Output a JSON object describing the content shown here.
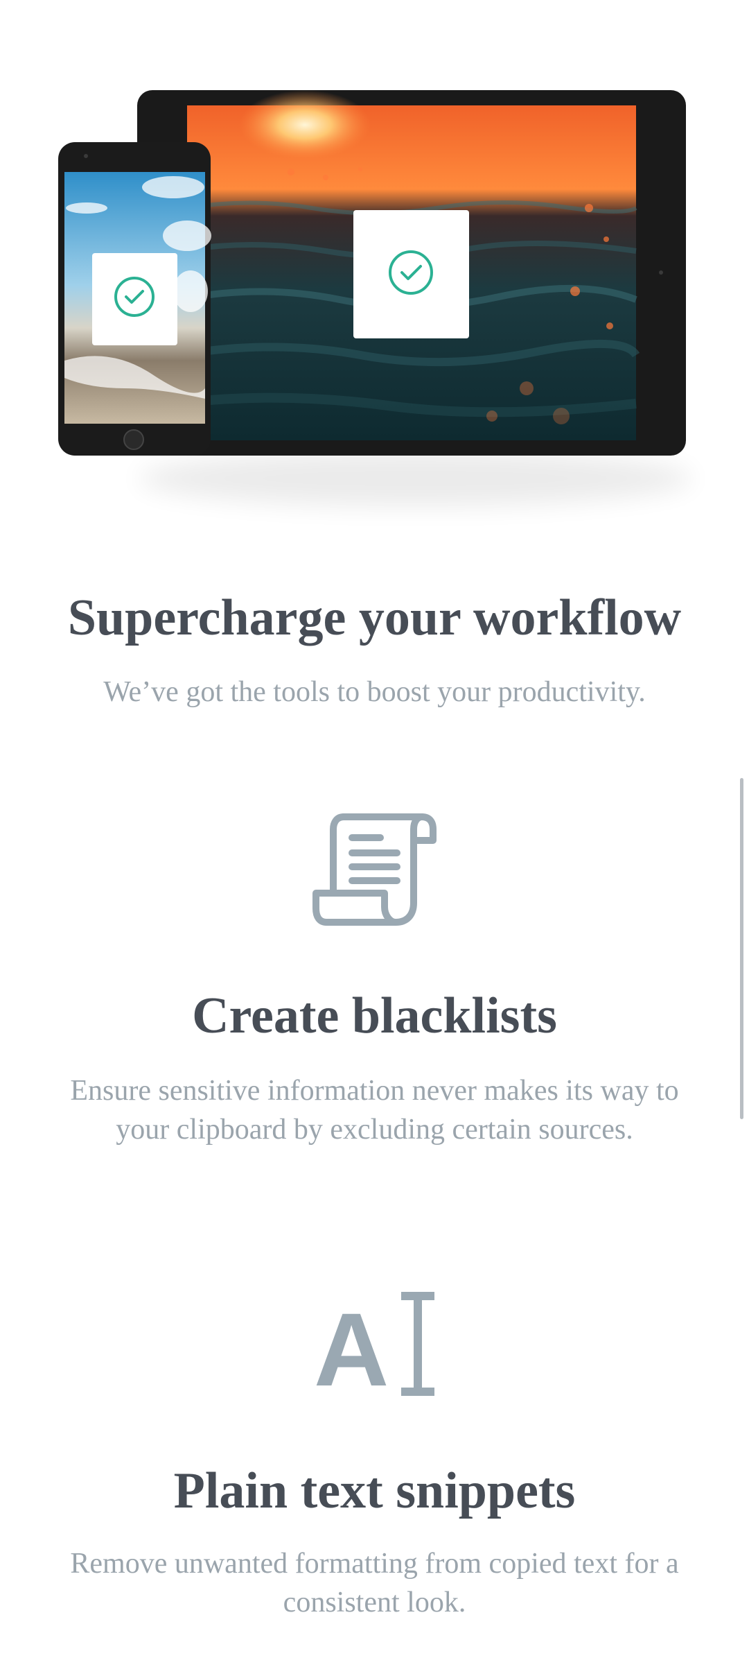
{
  "hero": {
    "tablet_image": "sunset-ocean-waves",
    "phone_image": "beach-sky",
    "card_icon": "check-circle-icon",
    "accent_color": "#2bb193"
  },
  "intro": {
    "title": "Supercharge your workflow",
    "subtitle": "We’ve got the tools to boost your productivity."
  },
  "features": [
    {
      "icon": "scroll-document-icon",
      "title": "Create blacklists",
      "description": "Ensure sensitive information never makes its way to your clipboard by excluding certain sources."
    },
    {
      "icon": "text-cursor-icon",
      "icon_text": "A",
      "title": "Plain text snippets",
      "description": "Remove unwanted formatting from copied text for a consistent look."
    }
  ],
  "colors": {
    "heading": "#474d56",
    "body": "#9aa4ac",
    "icon": "#9aa8b2"
  }
}
